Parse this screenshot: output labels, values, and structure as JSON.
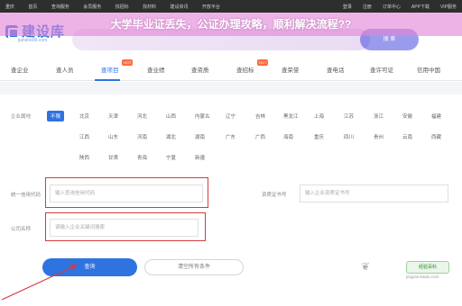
{
  "topbar": {
    "left_items": [
      "重庆",
      "首页",
      "查询服务",
      "会员服务",
      "找招标",
      "找材料",
      "建设资讯",
      "开放平台"
    ],
    "right_items": [
      "登录",
      "注册",
      "订单中心",
      "APP下载",
      "VIP服务"
    ]
  },
  "logo": {
    "text": "建设库",
    "subtitle": "jianshe99.com"
  },
  "overlay": {
    "title": "大学毕业证丢失，公证办理攻略，顺利解决流程??"
  },
  "search": {
    "button_label": "搜 索"
  },
  "nav": {
    "items": [
      "查企业",
      "查人员",
      "查项目",
      "查业绩",
      "查资质",
      "查招标",
      "查荣誉",
      "查电话",
      "查许可证",
      "信用中国"
    ],
    "hot_badge": "HOT"
  },
  "filters": {
    "region_label": "企业属地",
    "regions_row1": [
      "不限",
      "北京",
      "天津",
      "河北",
      "山西",
      "内蒙古",
      "辽宁",
      "吉林",
      "黑龙江",
      "上海",
      "江苏",
      "浙江",
      "安徽",
      "福建"
    ],
    "regions_row2": [
      "江西",
      "山东",
      "河南",
      "湖北",
      "湖南",
      "广东",
      "广西",
      "海南",
      "重庆",
      "四川",
      "贵州",
      "云南",
      "西藏"
    ],
    "regions_row3": [
      "陕西",
      "甘肃",
      "青海",
      "宁夏",
      "新疆"
    ],
    "credit_code_label": "统一信用代码",
    "credit_code_placeholder": "输入查询信用代码",
    "cert_label": "资质证书号",
    "cert_placeholder": "输入企业资质证书号",
    "company_label": "公司名称",
    "company_placeholder": "请输入企业关键词搜索"
  },
  "actions": {
    "search_label": "查询",
    "reset_label": "清空所有条件"
  },
  "watermark": {
    "badge": "经验百科",
    "sub": "jingyan.baidu.com"
  },
  "colors": {
    "accent": "#2f73e0",
    "overlay": "#e284d6",
    "highlight": "#d63a3a"
  }
}
